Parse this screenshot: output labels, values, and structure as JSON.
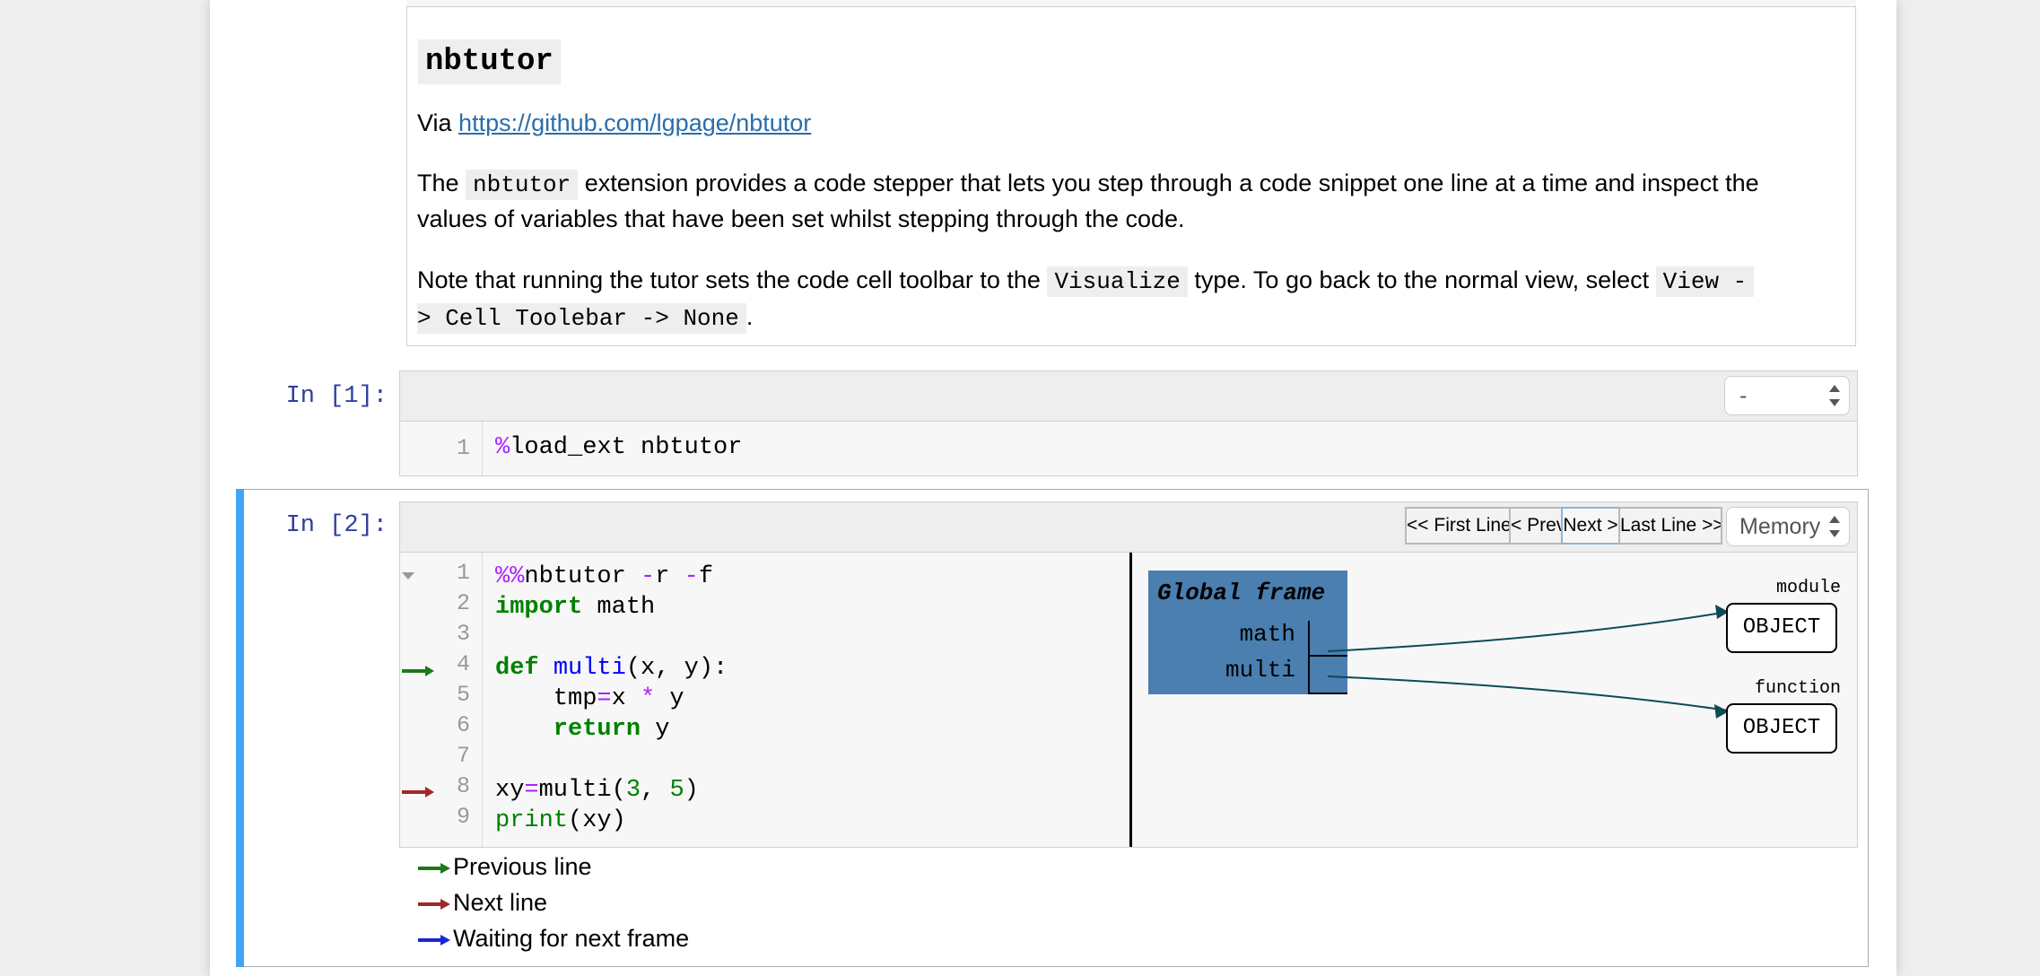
{
  "markdown": {
    "heading": "nbtutor",
    "via_prefix": "Via ",
    "via_link": "https://github.com/lgpage/nbtutor",
    "p1_a": "The ",
    "p1_code": "nbtutor",
    "p1_b": " extension provides a code stepper that lets you step through a code snippet one line at a time and inspect the",
    "p1_c": "values of variables that have been set whilst stepping through the code.",
    "p2_a": "Note that running the tutor sets the code cell toolbar to the ",
    "p2_code1": "Visualize",
    "p2_b": " type. To go back to the normal view, select ",
    "p2_code2a": "View -",
    "p2_code2b": "> Cell Toolebar -> None",
    "p2_c": "."
  },
  "cell1": {
    "prompt": "In [1]:",
    "toolbar_select": "-",
    "lines": [
      {
        "no": "1",
        "magic": "%",
        "text": "load_ext nbtutor"
      }
    ]
  },
  "cell2": {
    "prompt": "In [2]:",
    "buttons": {
      "first": "<< First Line",
      "prev": "< Prev",
      "next": "Next >",
      "last": "Last Line >>"
    },
    "toolbar_select": "Memory",
    "line_numbers": [
      "1",
      "2",
      "3",
      "4",
      "5",
      "6",
      "7",
      "8",
      "9"
    ],
    "code": {
      "l1_magic": "%%",
      "l1_name": "nbtutor ",
      "l1_flag1": "-",
      "l1_f1": "r ",
      "l1_flag2": "-",
      "l1_f2": "f",
      "l2_kw": "import",
      "l2_rest": " math",
      "l4_kw": "def",
      "l4_fn": "multi",
      "l4_rest": "(x, y):",
      "l5_a": "    tmp",
      "l5_eq": "=",
      "l5_b": "x ",
      "l5_op": "*",
      "l5_c": " y",
      "l6_kw": "    return",
      "l6_rest": " y",
      "l8_a": "xy",
      "l8_eq": "=",
      "l8_b": "multi(",
      "l8_n1": "3",
      "l8_c": ", ",
      "l8_n2": "5",
      "l8_d": ")",
      "l9_kw": "print",
      "l9_rest": "(xy)"
    },
    "viz": {
      "frame_title": "Global frame",
      "vars": [
        "math",
        "multi"
      ],
      "objects": [
        {
          "type": "module",
          "label": "OBJECT"
        },
        {
          "type": "function",
          "label": "OBJECT"
        }
      ]
    },
    "legend": [
      {
        "label": "Previous line",
        "color": "#1a7a1a"
      },
      {
        "label": "Next line",
        "color": "#a02828"
      },
      {
        "label": "Waiting for next frame",
        "color": "#1a24d8"
      }
    ]
  },
  "colors": {
    "accent": "#42a5f5",
    "prompt": "#303f9f",
    "link": "#296eaa",
    "frame_bg": "#4a7fb0",
    "arrow": "#0d4a57"
  }
}
